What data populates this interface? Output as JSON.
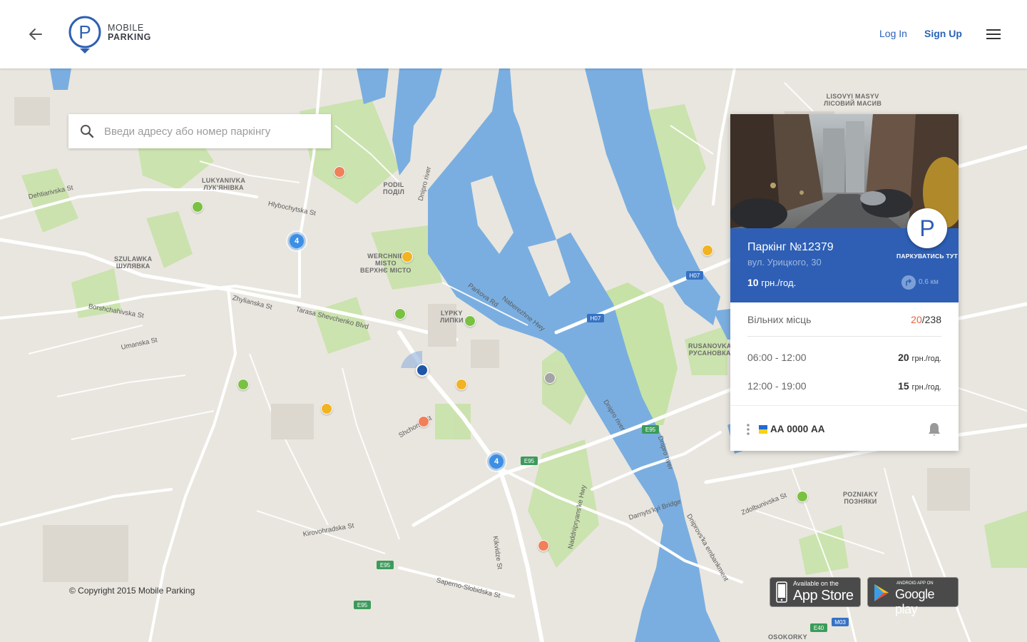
{
  "header": {
    "logo_line1": "MOBILE",
    "logo_line2": "PARKING",
    "login_label": "Log In",
    "signup_label": "Sign Up"
  },
  "search": {
    "placeholder": "Введи адресу або номер паркінгу"
  },
  "card": {
    "title": "Паркінг №12379",
    "address": "вул. Урицкого, 30",
    "price_value": "10",
    "price_unit": "грн./год.",
    "distance": "0.6 км",
    "park_button_letter": "P",
    "park_button_label": "ПАРКУВАТИСЬ ТУТ",
    "free_places_label": "Вільних місць",
    "free_places_count": "20",
    "free_places_total": "/238",
    "schedule": [
      {
        "time": "06:00 - 12:00",
        "price": "20",
        "unit": "грн./год."
      },
      {
        "time": "12:00 - 19:00",
        "price": "15",
        "unit": "грн./год."
      }
    ],
    "plate": "АА 0000 АА"
  },
  "map": {
    "clusters": [
      "4",
      "4"
    ],
    "labels": {
      "lukyanivka": "LUKYANIVKA",
      "lukyanivka_ua": "ЛУК'ЯНІВКА",
      "podil": "PODIL",
      "podil_ua": "ПОДІЛ",
      "werchnie": "WERCHNIE",
      "misto": "MISTO",
      "verhne": "ВЕРХНЄ МІСТО",
      "szulawka": "SZULAWKA",
      "szulawka_ua": "ШУЛЯВКА",
      "lypky": "LYPKY",
      "lypky_ua": "ЛИПКИ",
      "rusanovka": "RUSANOVKA",
      "rusanovka_ua": "РУСАНОВКА",
      "pozniaky": "POZNIAKY",
      "pozniaky_ua": "ПОЗНЯКИ",
      "osokorky": "OSOKORKY",
      "lisovyi": "LISOVYI MASYV",
      "lisovyi_ua": "ЛІСОВИЙ МАСИВ",
      "dehtiarivska": "Dehtiarivska St",
      "tarasa": "Tarasa Shevchenko Blvd",
      "zhylianska": "Zhylianska St",
      "borshchahivska": "Borshchahivska St",
      "umanska": "Umanska St",
      "parkova": "Parkova Rd",
      "naberezhne": "Naberezhne Hwy",
      "dnipro1": "Dnipro river",
      "dnipro2": "Dnipro river",
      "dnipro3": "Dnipro river",
      "darnytskyi": "Darnyts'kyi Bridge",
      "dniprovska": "Dniprovs'ka embankment",
      "shchorsa": "Shchorsa St",
      "kikvidze": "Kikvidze St",
      "saperno": "Saperno-Slobidska St",
      "zdolbunivska": "Zdolbunivska St",
      "hlybochytska": "Hlybochytska St",
      "kirovohradska": "Kirovohradska St",
      "naddnipryanske": "Naddnipryans'ke Hwy",
      "e95": "E95",
      "h07": "H07",
      "m03": "M03",
      "e40": "E40"
    }
  },
  "footer": {
    "copyright": "© Copyright 2015 Mobile Parking",
    "appstore_small": "Available on the",
    "appstore_big": "App Store",
    "google_small": "ANDROID APP ON",
    "google_big": "Google play"
  },
  "colors": {
    "brand_blue": "#2e5fb4",
    "link_blue": "#2a63b8",
    "water": "#7aaee0",
    "park": "#c3e0a4",
    "marker_green": "#7ac142",
    "marker_orange": "#f0805a",
    "marker_yellow": "#f2b322",
    "marker_grey": "#a4a4a4",
    "cluster_blue": "#3d8ee5",
    "free_places_highlight": "#e8643c"
  },
  "icons": {
    "back": "arrow-left-icon",
    "menu": "hamburger-icon",
    "search": "search-icon",
    "distance": "turn-right-icon",
    "bell": "bell-icon",
    "dots": "more-vertical-icon"
  }
}
